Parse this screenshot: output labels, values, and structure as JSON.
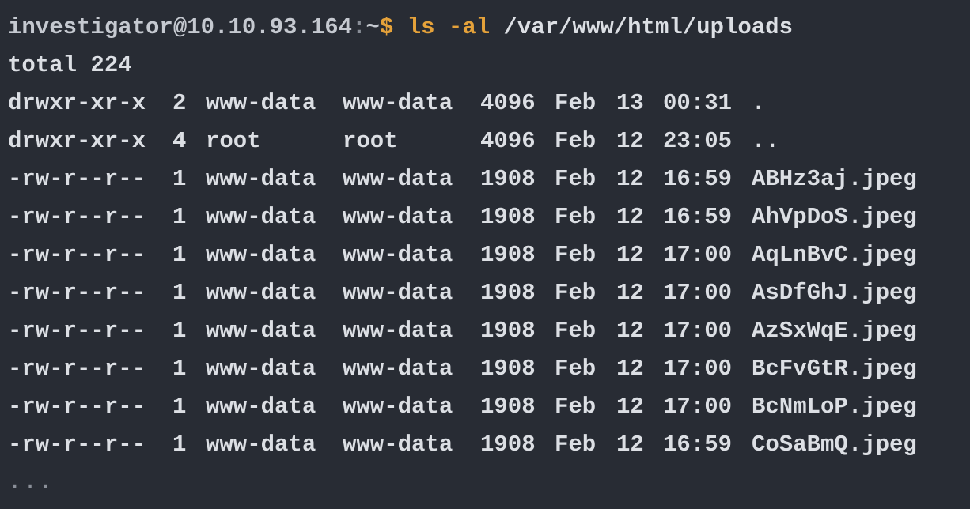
{
  "prompt": {
    "user_host": "investigator@10.10.93.164",
    "separator": ":",
    "path": "~",
    "symbol": "$",
    "command": "ls -al",
    "argument": "/var/www/html/uploads"
  },
  "total_line": "total 224",
  "colors": {
    "background": "#282c34",
    "text": "#dcdfe4",
    "accent_command": "#e5a23a"
  },
  "entries": [
    {
      "perm": "drwxr-xr-x",
      "links": "2",
      "owner": "www-data",
      "group": "www-data",
      "size": "4096",
      "month": "Feb",
      "day": "13",
      "time": "00:31",
      "name": "."
    },
    {
      "perm": "drwxr-xr-x",
      "links": "4",
      "owner": "root",
      "group": "root",
      "size": "4096",
      "month": "Feb",
      "day": "12",
      "time": "23:05",
      "name": ".."
    },
    {
      "perm": "-rw-r--r--",
      "links": "1",
      "owner": "www-data",
      "group": "www-data",
      "size": "1908",
      "month": "Feb",
      "day": "12",
      "time": "16:59",
      "name": "ABHz3aj.jpeg"
    },
    {
      "perm": "-rw-r--r--",
      "links": "1",
      "owner": "www-data",
      "group": "www-data",
      "size": "1908",
      "month": "Feb",
      "day": "12",
      "time": "16:59",
      "name": "AhVpDoS.jpeg"
    },
    {
      "perm": "-rw-r--r--",
      "links": "1",
      "owner": "www-data",
      "group": "www-data",
      "size": "1908",
      "month": "Feb",
      "day": "12",
      "time": "17:00",
      "name": "AqLnBvC.jpeg"
    },
    {
      "perm": "-rw-r--r--",
      "links": "1",
      "owner": "www-data",
      "group": "www-data",
      "size": "1908",
      "month": "Feb",
      "day": "12",
      "time": "17:00",
      "name": "AsDfGhJ.jpeg"
    },
    {
      "perm": "-rw-r--r--",
      "links": "1",
      "owner": "www-data",
      "group": "www-data",
      "size": "1908",
      "month": "Feb",
      "day": "12",
      "time": "17:00",
      "name": "AzSxWqE.jpeg"
    },
    {
      "perm": "-rw-r--r--",
      "links": "1",
      "owner": "www-data",
      "group": "www-data",
      "size": "1908",
      "month": "Feb",
      "day": "12",
      "time": "17:00",
      "name": "BcFvGtR.jpeg"
    },
    {
      "perm": "-rw-r--r--",
      "links": "1",
      "owner": "www-data",
      "group": "www-data",
      "size": "1908",
      "month": "Feb",
      "day": "12",
      "time": "17:00",
      "name": "BcNmLoP.jpeg"
    },
    {
      "perm": "-rw-r--r--",
      "links": "1",
      "owner": "www-data",
      "group": "www-data",
      "size": "1908",
      "month": "Feb",
      "day": "12",
      "time": "16:59",
      "name": "CoSaBmQ.jpeg"
    }
  ],
  "ellipsis": "..."
}
